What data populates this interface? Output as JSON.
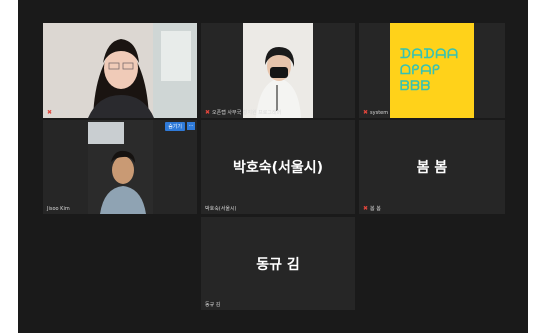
{
  "participants": [
    {
      "name": "채은 김",
      "muted": true,
      "active": true,
      "video": true
    },
    {
      "name": "오픈랩 사무국 황지원 프로그래머",
      "muted": true,
      "video": true
    },
    {
      "name": "system",
      "muted": true,
      "video": true
    },
    {
      "name": "Jisoo Kim",
      "muted": false,
      "video": true,
      "badge": "숨기기",
      "more": "..."
    },
    {
      "name": "박호숙(서울시)",
      "muted": false,
      "video": false,
      "display": "박호숙(서울시)"
    },
    {
      "name": "봄 봄",
      "muted": true,
      "video": false,
      "display": "봄 봄"
    },
    {
      "name": "동규 김",
      "muted": false,
      "video": false,
      "display": "동규 김"
    }
  ],
  "artwork_lines": [
    "ᗪᗩᗪᗩᗩ",
    "ᗝᑭᗩᑭ",
    "ᗷᗷᗷ"
  ],
  "colors": {
    "active_border": "#c9e86a",
    "mic_muted": "#e2453c",
    "artwork_bg": "#ffd21a",
    "artwork_fg": "#35c2b3"
  }
}
